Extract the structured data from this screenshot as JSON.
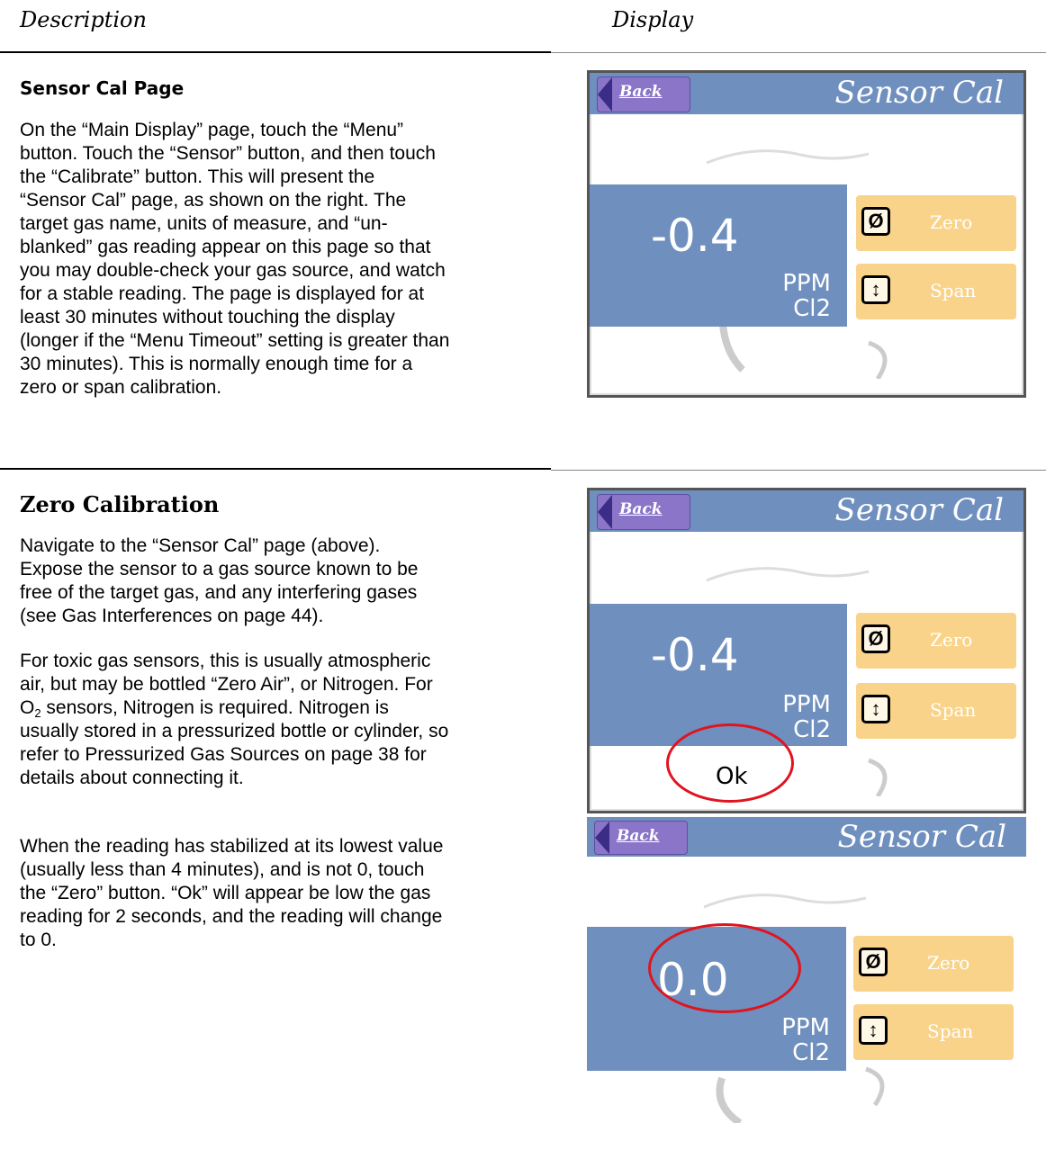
{
  "headers": {
    "description": "Description",
    "display": "Display"
  },
  "section1": {
    "title": "Sensor Cal Page",
    "paragraph": [
      "On the “Main Display” page, touch the “Menu”",
      "button.  Touch the “Sensor” button, and then touch",
      "the “Calibrate” button.  This will present the",
      "“Sensor Cal” page, as shown on the right.  The",
      "target gas name, units of measure, and “un-",
      "blanked” gas reading appear on this page so that",
      "you may double-check your gas source, and watch",
      "for a stable reading.  The page is displayed for at",
      "least 30 minutes without touching the display",
      "(longer if the “Menu Timeout” setting is greater than",
      "30 minutes).  This is normally enough time for a",
      "zero or span calibration."
    ]
  },
  "section2": {
    "title": "Zero Calibration",
    "p1": [
      "Navigate to the “Sensor Cal” page (above).",
      "Expose the sensor to a gas source known to be",
      "free of the target gas, and any interfering gases",
      "(see Gas Interferences on page 44)."
    ],
    "p2_lines": [
      "For toxic gas sensors, this is usually atmospheric",
      "air, but may be bottled “Zero Air”, or Nitrogen.  For"
    ],
    "p2_o2_main": "O",
    "p2_o2_sub": "2",
    "p2_o2_rest": " sensors, Nitrogen is required.  Nitrogen is",
    "p2_tail": [
      "usually stored in a pressurized bottle or cylinder, so",
      "refer to Pressurized Gas Sources on page 38 for",
      "details about connecting it."
    ],
    "p3": [
      "When the reading has stabilized at its lowest value",
      "(usually less than 4 minutes), and is not 0, touch",
      "the “Zero” button.  “Ok” will appear be low the gas",
      "reading for 2 seconds, and the reading will change",
      "to 0."
    ]
  },
  "screens": [
    {
      "title": "Sensor Cal",
      "back": "Back",
      "reading": "-0.4",
      "unit": "PPM",
      "gas": "Cl2",
      "zero_label": "Zero",
      "span_label": "Span",
      "zero_icon": "Ø",
      "span_icon": "↕"
    },
    {
      "title": "Sensor Cal",
      "back": "Back",
      "reading": "-0.4",
      "unit": "PPM",
      "gas": "Cl2",
      "zero_label": "Zero",
      "span_label": "Span",
      "zero_icon": "Ø",
      "span_icon": "↕",
      "ok": "Ok"
    },
    {
      "title": "Sensor Cal",
      "back": "Back",
      "reading": "0.0",
      "unit": "PPM",
      "gas": "Cl2",
      "zero_label": "Zero",
      "span_label": "Span",
      "zero_icon": "Ø",
      "span_icon": "↕"
    }
  ],
  "colors": {
    "screen_blue": "#6f8fbe",
    "button_yellow": "#fad38a",
    "back_purple": "#8a75c8",
    "highlight_red": "#e0141e"
  }
}
